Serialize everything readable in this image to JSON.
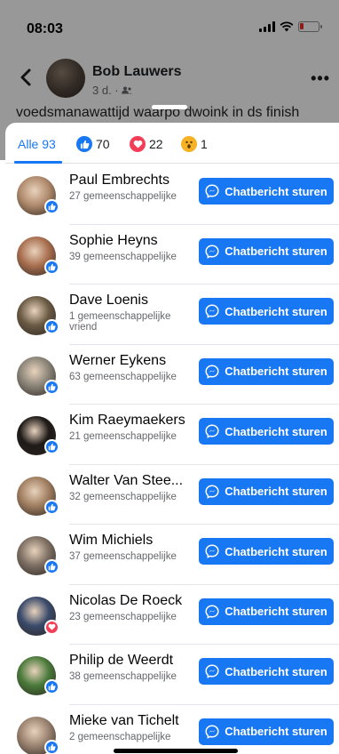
{
  "status_bar": {
    "time": "08:03"
  },
  "post_header": {
    "name": "Bob Lauwers",
    "meta": "3 d. · "
  },
  "background_text": "voedsmanawattijd waarpo dwoink in ds finish",
  "tabs": [
    {
      "label": "Alle 93"
    },
    {
      "label": "70",
      "reaction": "like"
    },
    {
      "label": "22",
      "reaction": "love"
    },
    {
      "label": "1",
      "reaction": "wow"
    }
  ],
  "button_label": "Chatbericht sturen",
  "people": [
    {
      "name": "Paul Embrechts",
      "mutual": "27 gemeenschappelijke",
      "reaction": "like",
      "avatar_color": "#b08a6c"
    },
    {
      "name": "Sophie Heyns",
      "mutual": "39 gemeenschappelijke",
      "reaction": "like",
      "avatar_color": "#a86e4e"
    },
    {
      "name": "Dave Loenis",
      "mutual": "1 gemeenschappelijke vriend",
      "reaction": "like",
      "avatar_color": "#6a5a44"
    },
    {
      "name": "Werner Eykens",
      "mutual": "63 gemeenschappelijke",
      "reaction": "like",
      "avatar_color": "#8a8478"
    },
    {
      "name": "Kim Raeymaekers",
      "mutual": "21 gemeenschappelijke",
      "reaction": "like",
      "avatar_color": "#1e1a18"
    },
    {
      "name": "Walter Van Stee...",
      "mutual": "32 gemeenschappelijke",
      "reaction": "like",
      "avatar_color": "#a07e60"
    },
    {
      "name": "Wim Michiels",
      "mutual": "37 gemeenschappelijke",
      "reaction": "like",
      "avatar_color": "#7c6e62"
    },
    {
      "name": "Nicolas De Roeck",
      "mutual": "23 gemeenschappelijke",
      "reaction": "love",
      "avatar_color": "#3a4a6a"
    },
    {
      "name": "Philip de Weerdt",
      "mutual": "38 gemeenschappelijke",
      "reaction": "like",
      "avatar_color": "#4a7a3a"
    },
    {
      "name": "Mieke van Tichelt",
      "mutual": "2 gemeenschappelijke",
      "reaction": "like",
      "avatar_color": "#9a8270"
    }
  ],
  "colors": {
    "accent": "#1877f2",
    "love": "#f33e58",
    "wow": "#f7b125"
  }
}
